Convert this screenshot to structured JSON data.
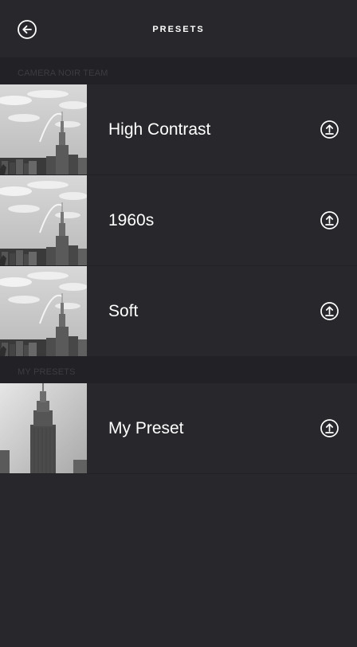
{
  "header": {
    "title": "PRESETS",
    "back_icon": "back-arrow-circle-icon"
  },
  "sections": [
    {
      "label": "CAMERA NOIR TEAM",
      "items": [
        {
          "label": "High Contrast",
          "action_icon": "upload-circle-icon"
        },
        {
          "label": "1960s",
          "action_icon": "upload-circle-icon"
        },
        {
          "label": "Soft",
          "action_icon": "upload-circle-icon"
        }
      ]
    },
    {
      "label": "MY PRESETS",
      "items": [
        {
          "label": "My Preset",
          "action_icon": "upload-circle-icon"
        }
      ]
    }
  ],
  "colors": {
    "background": "#28272c",
    "section_background": "#222126",
    "section_text": "#3d3c41",
    "text": "#ffffff"
  }
}
